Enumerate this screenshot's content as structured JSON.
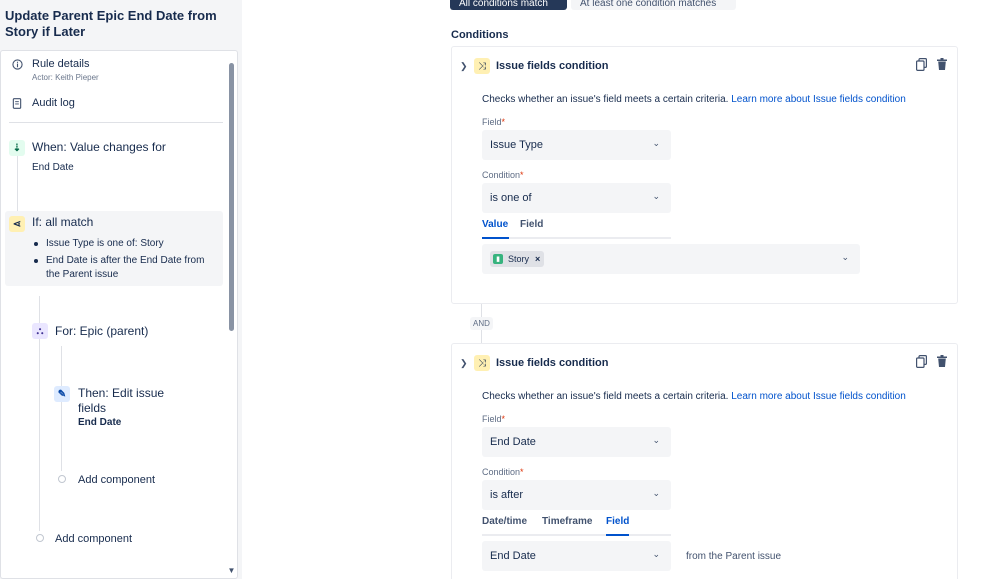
{
  "rule": {
    "title": "Update Parent Epic End Date from Story if Later"
  },
  "sidebar": {
    "rule_details": "Rule details",
    "actor": "Actor: Keith Pieper",
    "audit_log": "Audit log",
    "trigger": {
      "title": "When: Value changes for",
      "field": "End Date"
    },
    "condition": {
      "title": "If: all match",
      "items": [
        "Issue Type is one of: Story",
        "End Date is after the End Date from the Parent issue"
      ]
    },
    "branch": {
      "title": "For: Epic (parent)"
    },
    "action": {
      "title": "Then: Edit issue fields",
      "field": "End Date"
    },
    "add_component_inner": "Add component",
    "add_component_outer": "Add component"
  },
  "match_tabs": {
    "all": "All conditions match",
    "one": "At least one condition matches"
  },
  "conditions_heading": "Conditions",
  "cards": [
    {
      "title": "Issue fields condition",
      "description": "Checks whether an issue's field meets a certain criteria.",
      "learn_more": "Learn more about Issue fields condition",
      "field_label": "Field",
      "field_value": "Issue Type",
      "condition_label": "Condition",
      "condition_value": "is one of",
      "tabs": [
        "Value",
        "Field"
      ],
      "chip": "Story"
    },
    {
      "title": "Issue fields condition",
      "description": "Checks whether an issue's field meets a certain criteria.",
      "learn_more": "Learn more about Issue fields condition",
      "field_label": "Field",
      "field_value": "End Date",
      "condition_label": "Condition",
      "condition_value": "is after",
      "tabs": [
        "Date/time",
        "Timeframe",
        "Field"
      ],
      "compare_value": "End Date",
      "compare_suffix": "from the Parent issue"
    }
  ],
  "and_label": "AND",
  "required_marker": "*",
  "icons": {
    "info": "info-icon",
    "audit": "document-icon",
    "trigger": "trigger-icon",
    "condition": "condition-icon",
    "branch": "branch-icon",
    "action": "pencil-icon",
    "copy": "copy-icon",
    "delete": "trash-icon"
  },
  "colors": {
    "accent": "#0052cc",
    "primary_button": "#253858",
    "trigger": "#e3fcef",
    "condition": "#fff0b3",
    "branch": "#eae6ff",
    "action": "#deebff"
  }
}
